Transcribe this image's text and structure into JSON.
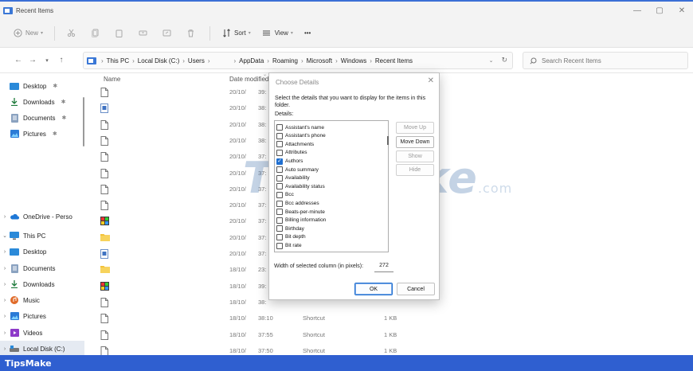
{
  "window": {
    "title": "Recent Items",
    "controls": {
      "minimize": "—",
      "maximize": "▢",
      "close": "✕"
    }
  },
  "toolbar": {
    "new_label": "New",
    "sort_label": "Sort",
    "view_label": "View",
    "more_label": "•••"
  },
  "address": {
    "crumbs": [
      "This PC",
      "Local Disk (C:)",
      "Users",
      "AppData",
      "Roaming",
      "Microsoft",
      "Windows",
      "Recent Items"
    ],
    "search_placeholder": "Search Recent Items"
  },
  "sidebar": {
    "items": [
      {
        "label": "Desktop",
        "icon": "desktop-folder-icon",
        "pinned": true
      },
      {
        "label": "Downloads",
        "icon": "download-icon",
        "pinned": true
      },
      {
        "label": "Documents",
        "icon": "documents-icon",
        "pinned": true
      },
      {
        "label": "Pictures",
        "icon": "pictures-icon",
        "pinned": true
      },
      {
        "label": "OneDrive - Perso",
        "icon": "cloud-icon"
      },
      {
        "label": "This PC",
        "icon": "pc-icon",
        "expanded": true
      },
      {
        "label": "Desktop",
        "icon": "desktop-folder-icon"
      },
      {
        "label": "Documents",
        "icon": "documents-icon"
      },
      {
        "label": "Downloads",
        "icon": "download-icon"
      },
      {
        "label": "Music",
        "icon": "music-icon"
      },
      {
        "label": "Pictures",
        "icon": "pictures-icon"
      },
      {
        "label": "Videos",
        "icon": "videos-icon"
      },
      {
        "label": "Local Disk (C:)",
        "icon": "drive-icon",
        "selected": true
      }
    ]
  },
  "filelist": {
    "columns": {
      "name": "Name",
      "date": "Date modified"
    },
    "rows": [
      {
        "icon": "file-icon",
        "date": "20/10/",
        "time": "39:",
        "type": "",
        "size": ""
      },
      {
        "icon": "doc-icon",
        "date": "20/10/",
        "time": "38:",
        "type": "",
        "size": ""
      },
      {
        "icon": "file-icon",
        "date": "20/10/",
        "time": "38:",
        "type": "",
        "size": ""
      },
      {
        "icon": "file-icon",
        "date": "20/10/",
        "time": "38:",
        "type": "",
        "size": ""
      },
      {
        "icon": "file-icon",
        "date": "20/10/",
        "time": "37:",
        "type": "",
        "size": ""
      },
      {
        "icon": "file-icon",
        "date": "20/10/",
        "time": "37:",
        "type": "",
        "size": ""
      },
      {
        "icon": "file-icon",
        "date": "20/10/",
        "time": "37:",
        "type": "",
        "size": ""
      },
      {
        "icon": "file-icon",
        "date": "20/10/",
        "time": "37:",
        "type": "",
        "size": ""
      },
      {
        "icon": "image-icon",
        "date": "20/10/",
        "time": "37:",
        "type": "",
        "size": ""
      },
      {
        "icon": "folder-icon",
        "date": "20/10/",
        "time": "37:",
        "type": "",
        "size": ""
      },
      {
        "icon": "doc-icon",
        "date": "20/10/",
        "time": "37:",
        "type": "",
        "size": ""
      },
      {
        "icon": "folder-icon",
        "date": "18/10/",
        "time": "23:",
        "type": "",
        "size": ""
      },
      {
        "icon": "image-icon",
        "date": "18/10/",
        "time": "39:",
        "type": "",
        "size": ""
      },
      {
        "icon": "file-icon",
        "date": "18/10/",
        "time": "38:",
        "type": "",
        "size": ""
      },
      {
        "icon": "file-icon",
        "date": "18/10/",
        "time": "38:10",
        "type": "Shortcut",
        "size": "1 KB"
      },
      {
        "icon": "file-icon",
        "date": "18/10/",
        "time": "37:55",
        "type": "Shortcut",
        "size": "1 KB"
      },
      {
        "icon": "file-icon",
        "date": "18/10/",
        "time": "37:50",
        "type": "Shortcut",
        "size": "1 KB"
      }
    ]
  },
  "dialog": {
    "title": "Choose Details",
    "close": "✕",
    "description": "Select the details that you want to display for the items in this folder.",
    "details_label": "Details:",
    "details": [
      {
        "label": "Assistant's name",
        "checked": false
      },
      {
        "label": "Assistant's phone",
        "checked": false
      },
      {
        "label": "Attachments",
        "checked": false
      },
      {
        "label": "Attributes",
        "checked": false
      },
      {
        "label": "Authors",
        "checked": true
      },
      {
        "label": "Auto summary",
        "checked": false
      },
      {
        "label": "Availability",
        "checked": false
      },
      {
        "label": "Availability status",
        "checked": false
      },
      {
        "label": "Bcc",
        "checked": false
      },
      {
        "label": "Bcc addresses",
        "checked": false
      },
      {
        "label": "Beats-per-minute",
        "checked": false
      },
      {
        "label": "Billing information",
        "checked": false
      },
      {
        "label": "Birthday",
        "checked": false
      },
      {
        "label": "Bit depth",
        "checked": false
      },
      {
        "label": "Bit rate",
        "checked": false
      }
    ],
    "buttons": {
      "move_up": "Move Up",
      "move_down": "Move Down",
      "show": "Show",
      "hide": "Hide",
      "ok": "OK",
      "cancel": "Cancel"
    },
    "width_label": "Width of selected column (in pixels):",
    "width_value": "272"
  },
  "watermark": {
    "text": "TipsMake",
    "suffix": ".com"
  },
  "brand": "TipsMake"
}
